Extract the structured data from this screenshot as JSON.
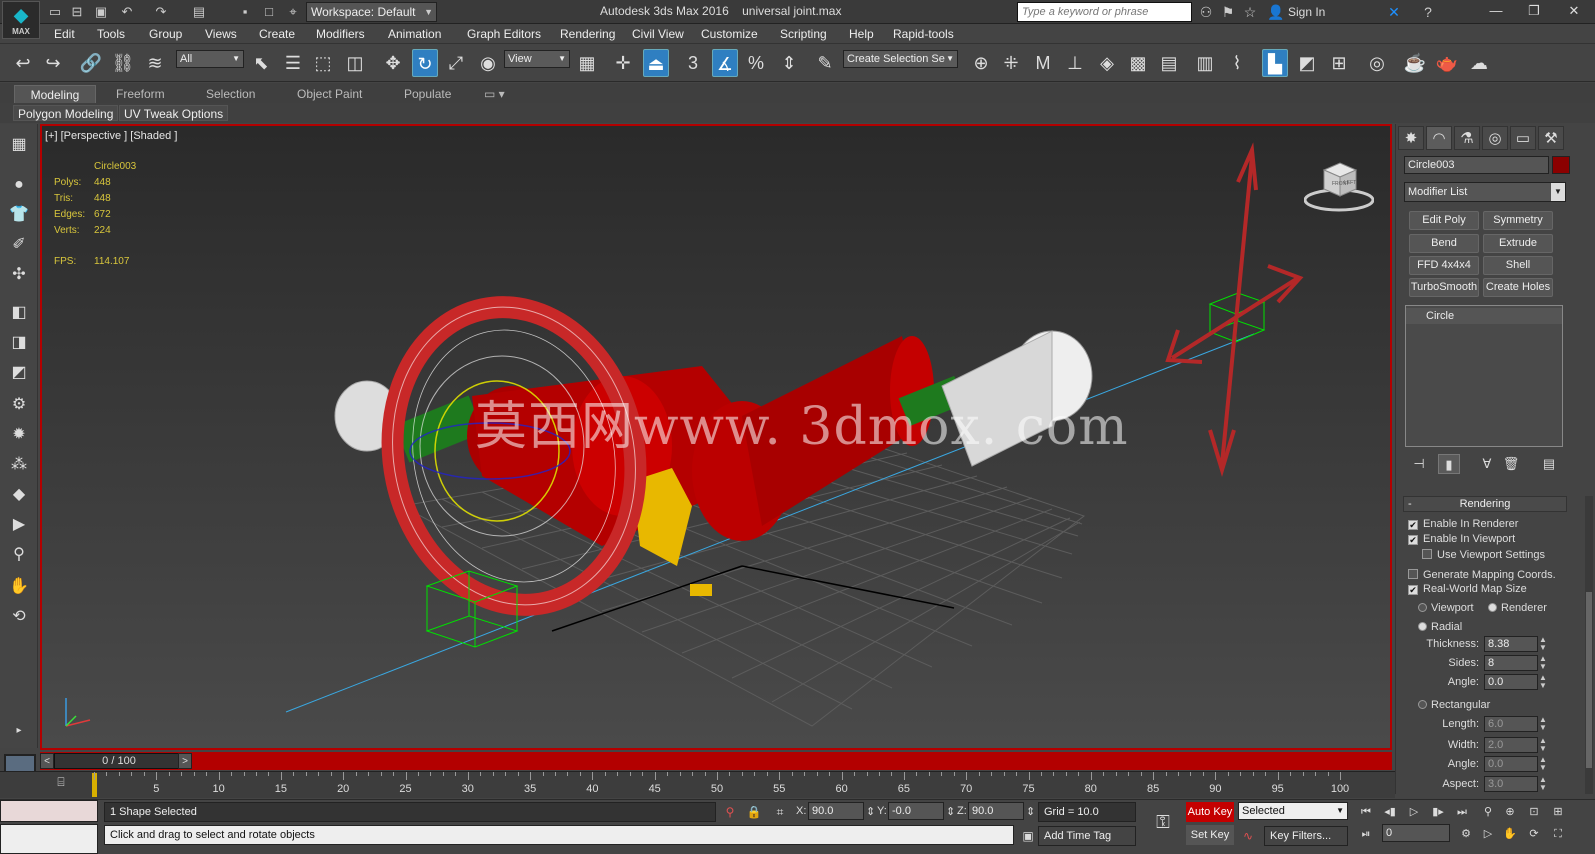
{
  "app": {
    "logo_text": "MAX",
    "workspace": "Workspace: Default",
    "title": "Autodesk 3ds Max 2016",
    "filename": "universal joint.max",
    "search_placeholder": "Type a keyword or phrase",
    "sign_in": "Sign In"
  },
  "menu": [
    "Edit",
    "Tools",
    "Group",
    "Views",
    "Create",
    "Modifiers",
    "Animation",
    "Graph Editors",
    "Rendering",
    "Civil View",
    "Customize",
    "Scripting",
    "Help",
    "Rapid-tools"
  ],
  "toolbar": {
    "filter": "All",
    "ref_coord": "View",
    "named_selection": "Create Selection Se",
    "snap_label": "3"
  },
  "ribbon": {
    "tabs": [
      "Modeling",
      "Freeform",
      "Selection",
      "Object Paint",
      "Populate"
    ],
    "active_tab": "Modeling",
    "sub_tabs": [
      "Polygon Modeling",
      "UV Tweak Options"
    ]
  },
  "viewport": {
    "label": "[+] [Perspective ] [Shaded ]",
    "object_name": "Circle003",
    "stats": [
      {
        "label": "Polys:",
        "value": "448"
      },
      {
        "label": "Tris:",
        "value": "448"
      },
      {
        "label": "Edges:",
        "value": "672"
      },
      {
        "label": "Verts:",
        "value": "224"
      }
    ],
    "fps_label": "FPS:",
    "fps_value": "114.107",
    "watermark": "莫西网www. 3dmox. com",
    "viewcube_front": "FRONT",
    "viewcube_right": "LEFT"
  },
  "command_panel": {
    "object_name": "Circle003",
    "object_color": "#8b0000",
    "modifier_list": "Modifier List",
    "modifier_buttons": [
      "Edit Poly",
      "Symmetry",
      "Bend",
      "Extrude",
      "FFD 4x4x4",
      "Shell",
      "TurboSmooth",
      "Create Holes"
    ],
    "stack_items": [
      "Circle"
    ],
    "rendering": {
      "header": "Rendering",
      "collapse": "-",
      "enable_renderer": "Enable In Renderer",
      "enable_renderer_checked": true,
      "enable_viewport": "Enable In Viewport",
      "enable_viewport_checked": true,
      "use_viewport_settings": "Use Viewport Settings",
      "use_viewport_settings_checked": false,
      "gen_mapping": "Generate Mapping Coords.",
      "gen_mapping_checked": false,
      "real_world": "Real-World Map Size",
      "real_world_checked": true,
      "viewport_radio": "Viewport",
      "renderer_radio": "Renderer",
      "radial": "Radial",
      "thickness_label": "Thickness:",
      "thickness": "8.38",
      "sides_label": "Sides:",
      "sides": "8",
      "angle_label": "Angle:",
      "angle": "0.0",
      "rectangular": "Rectangular",
      "length_label": "Length:",
      "length": "6.0",
      "width_label": "Width:",
      "width": "2.0",
      "rect_angle_label": "Angle:",
      "rect_angle": "0.0",
      "aspect_label": "Aspect:",
      "aspect": "3.0"
    }
  },
  "timeline": {
    "frame": "0 / 100",
    "ticks": [
      "5",
      "10",
      "15",
      "20",
      "25",
      "30",
      "35",
      "40",
      "45",
      "50",
      "55",
      "60",
      "65",
      "70",
      "75",
      "80",
      "85",
      "90",
      "95",
      "100"
    ]
  },
  "status": {
    "selection": "1 Shape Selected",
    "prompt": "Click and drag to select and rotate objects",
    "x_label": "X:",
    "x": "90.0",
    "y_label": "Y:",
    "y": "-0.0",
    "z_label": "Z:",
    "z": "90.0",
    "grid": "Grid = 10.0",
    "add_time_tag": "Add Time Tag",
    "auto_key": "Auto Key",
    "set_key": "Set Key",
    "selected": "Selected",
    "key_filters": "Key Filters...",
    "current_frame": "0"
  },
  "colors": {
    "accent_blue": "#2f7fc1",
    "viewport_border": "#b30000",
    "auto_key_red": "#c40000"
  }
}
